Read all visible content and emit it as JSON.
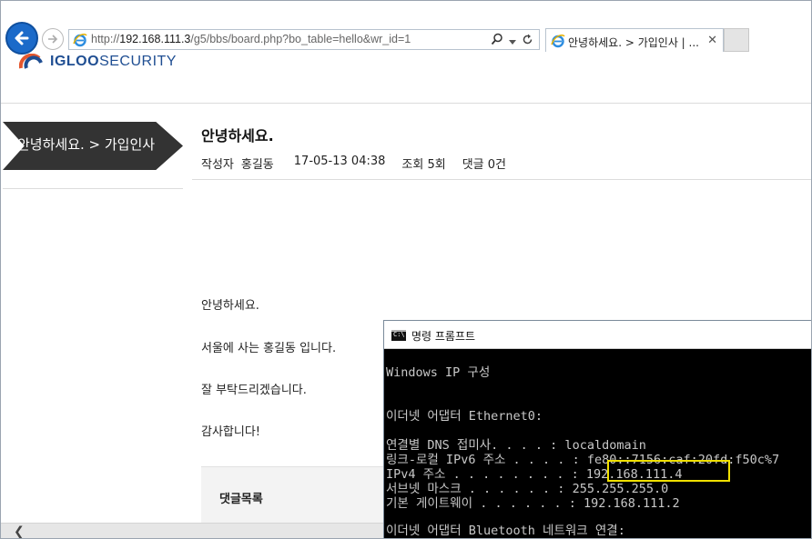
{
  "browser": {
    "url_prefix": "http://",
    "url_host": "192.168.111.3",
    "url_path": "/g5/bbs/board.php?bo_table=hello&wr_id=1",
    "tab_title": "안녕하세요. > 가입인사 | ...",
    "tab_close": "✕"
  },
  "site": {
    "logo_bold": "IGLOO",
    "logo_thin": "SECURITY",
    "brand_color": "#1f4e92"
  },
  "sidebar": {
    "banner_label": "안녕하세요. > 가입인사"
  },
  "post": {
    "title": "안녕하세요.",
    "author_label": "작성자",
    "author": "홍길동",
    "date": "17-05-13 04:38",
    "views": "조회 5회",
    "comments_count": "댓글 0건",
    "body": [
      "안녕하세요.",
      "서울에 사는 홍길동 입니다.",
      "잘 부탁드리겠습니다.",
      "감사합니다!"
    ],
    "comments_section_label": "댓글목록"
  },
  "cmd": {
    "title": "명령 프롬프트",
    "icon_text": "C:\\",
    "lines": [
      "Windows IP 구성",
      "이더넷 어댑터 Ethernet0:",
      "   연결별 DNS 접미사. . . . : localdomain",
      "   링크-로컬 IPv6 주소 . . . . : fe80::7156:caf:20fd:f50c%7",
      "   IPv4 주소 . . . . . . . . : 192.168.111.4",
      "   서브넷 마스크 . . . . . . : 255.255.255.0",
      "   기본 게이트웨이 . . . . . . : 192.168.111.2",
      "이더넷 어댑터 Bluetooth 네트워크 연결:"
    ],
    "highlight_color": "#f0e000"
  },
  "scrollbar": {
    "left_arrow": "❮"
  }
}
